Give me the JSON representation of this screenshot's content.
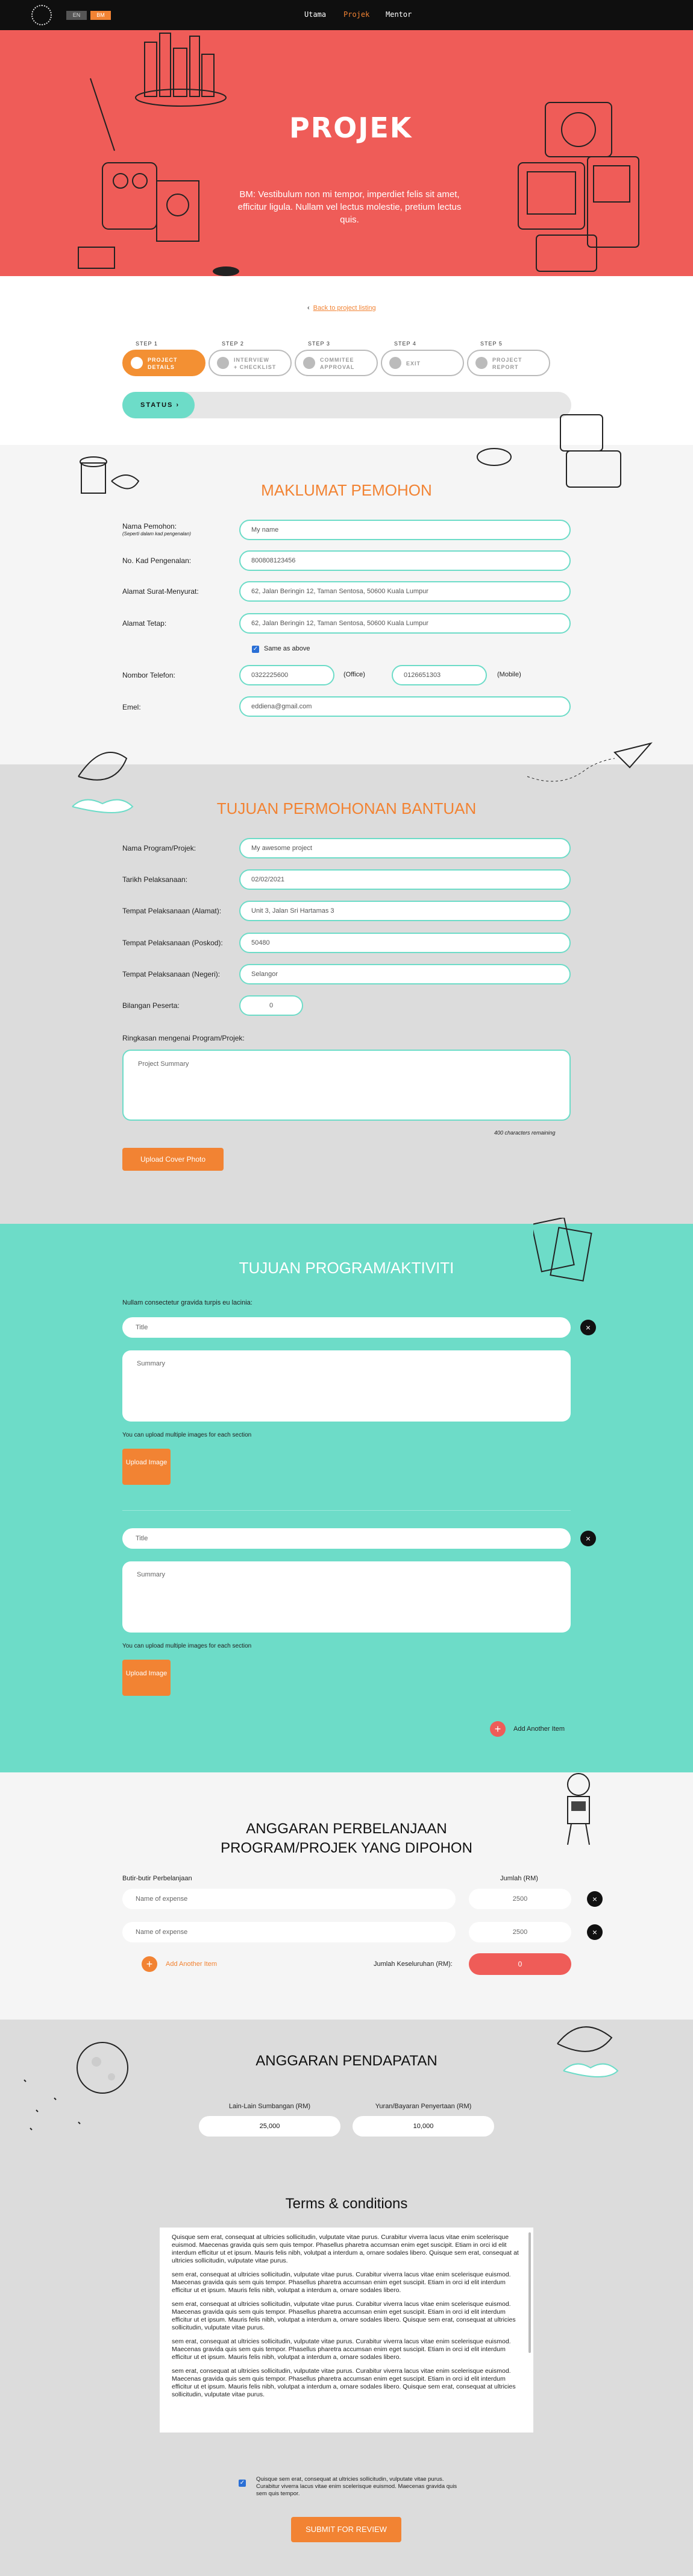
{
  "nav": {
    "lang_en": "EN",
    "lang_bm": "BM",
    "items": [
      "Utama",
      "Projek",
      "Mentor"
    ]
  },
  "hero": {
    "title": "PROJEK",
    "description": "BM: Vestibulum non mi tempor, imperdiet felis sit amet, efficitur ligula. Nullam vel lectus molestie, pretium lectus quis."
  },
  "back_link": "Back to project listing",
  "steps": [
    {
      "num": "STEP 1",
      "line1": "PROJECT",
      "line2": "DETAILS",
      "active": true
    },
    {
      "num": "STEP 2",
      "line1": "INTERVIEW",
      "line2": "+ CHECKLIST",
      "active": false
    },
    {
      "num": "STEP 3",
      "line1": "COMMITEE",
      "line2": "APPROVAL",
      "active": false
    },
    {
      "num": "STEP 4",
      "line1": "EXIT",
      "line2": "",
      "active": false
    },
    {
      "num": "STEP 5",
      "line1": "PROJECT",
      "line2": "REPORT",
      "active": false
    }
  ],
  "status_label": "STATUS ›",
  "maklumat": {
    "title": "MAKLUMAT PEMOHON",
    "nama_label": "Nama Pemohon:",
    "nama_note": "(Seperti dalam kad pengenalan)",
    "nama_value": "My name",
    "ic_label": "No. Kad Pengenalan:",
    "ic_value": "800808123456",
    "alamat_surat_label": "Alamat Surat-Menyurat:",
    "alamat_surat_value": "62, Jalan Beringin 12, Taman Sentosa, 50600 Kuala Lumpur",
    "alamat_tetap_label": "Alamat Tetap:",
    "alamat_tetap_value": "62, Jalan Beringin 12, Taman Sentosa, 50600 Kuala Lumpur",
    "same_as_above": "Same as above",
    "tel_label": "Nombor Telefon:",
    "tel_office": "0322225600",
    "tel_office_suffix": "(Office)",
    "tel_mobile": "0126651303",
    "tel_mobile_suffix": "(Mobile)",
    "emel_label": "Emel:",
    "emel_value": "eddiena@gmail.com"
  },
  "tujuan": {
    "title": "TUJUAN PERMOHONAN BANTUAN",
    "nama_program_label": "Nama Program/Projek:",
    "nama_program_value": "My awesome project",
    "tarikh_label": "Tarikh Pelaksanaan:",
    "tarikh_value": "02/02/2021",
    "alamat_label": "Tempat Pelaksanaan (Alamat):",
    "alamat_value": "Unit 3, Jalan Sri Hartamas 3",
    "poskod_label": "Tempat Pelaksanaan (Poskod):",
    "poskod_value": "50480",
    "negeri_label": "Tempat Pelaksanaan (Negeri):",
    "negeri_value": "Selangor",
    "peserta_label": "Bilangan Peserta:",
    "peserta_value": "0",
    "ringkasan_label": "Ringkasan mengenai Program/Projek:",
    "ringkasan_placeholder": "Project Summary",
    "chars_remaining": "400 characters remaining",
    "upload_cover": "Upload Cover Photo"
  },
  "aktiviti": {
    "title": "TUJUAN PROGRAM/AKTIVITI",
    "intro": "Nullam consectetur gravida turpis eu lacinia:",
    "blocks": [
      {
        "title_placeholder": "Title",
        "summary_placeholder": "Summary",
        "note": "You can upload multiple images for each section",
        "upload": "Upload Image"
      },
      {
        "title_placeholder": "Title",
        "summary_placeholder": "Summary",
        "note": "You can upload multiple images for each section",
        "upload": "Upload Image"
      }
    ],
    "add_item": "Add Another Item"
  },
  "belanja": {
    "title_line1": "ANGGARAN PERBELANJAAN",
    "title_line2": "PROGRAM/PROJEK YANG DIPOHON",
    "col_items": "Butir-butir Perbelanjaan",
    "col_amount": "Jumlah (RM)",
    "rows": [
      {
        "name": "Name of expense",
        "amount": "2500"
      },
      {
        "name": "Name of expense",
        "amount": "2500"
      }
    ],
    "add_item": "Add Another Item",
    "total_label": "Jumlah Keseluruhan (RM):",
    "total_value": "0"
  },
  "pendapatan": {
    "title": "ANGGARAN PENDAPATAN",
    "col1_label": "Lain-Lain Sumbangan (RM)",
    "col1_value": "25,000",
    "col2_label": "Yuran/Bayaran Penyertaan (RM)",
    "col2_value": "10,000"
  },
  "terms": {
    "title": "Terms & conditions",
    "paragraphs": [
      "Quisque sem erat, consequat at ultricies sollicitudin, vulputate vitae purus. Curabitur viverra lacus vitae enim scelerisque euismod. Maecenas gravida quis sem quis tempor. Phasellus pharetra accumsan enim eget suscipit. Etiam in orci id elit interdum efficitur ut et ipsum. Mauris felis nibh, volutpat a interdum a, ornare sodales libero. Quisque sem erat, consequat at ultricies sollicitudin, vulputate vitae purus.",
      "sem erat, consequat at ultricies sollicitudin, vulputate vitae purus. Curabitur viverra lacus vitae enim scelerisque euismod. Maecenas gravida quis sem quis tempor. Phasellus pharetra accumsan enim eget suscipit. Etiam in orci id elit interdum efficitur ut et ipsum. Mauris felis nibh, volutpat a interdum a, ornare sodales libero.",
      "sem erat, consequat at ultricies sollicitudin, vulputate vitae purus. Curabitur viverra lacus vitae enim scelerisque euismod. Maecenas gravida quis sem quis tempor. Phasellus pharetra accumsan enim eget suscipit. Etiam in orci id elit interdum efficitur ut et ipsum. Mauris felis nibh, volutpat a interdum a, ornare sodales libero. Quisque sem erat, consequat at ultricies sollicitudin, vulputate vitae purus.",
      "sem erat, consequat at ultricies sollicitudin, vulputate vitae purus. Curabitur viverra lacus vitae enim scelerisque euismod. Maecenas gravida quis sem quis tempor. Phasellus pharetra accumsan enim eget suscipit. Etiam in orci id elit interdum efficitur ut et ipsum. Mauris felis nibh, volutpat a interdum a, ornare sodales libero.",
      "sem erat, consequat at ultricies sollicitudin, vulputate vitae purus. Curabitur viverra lacus vitae enim scelerisque euismod. Maecenas gravida quis sem quis tempor. Phasellus pharetra accumsan enim eget suscipit. Etiam in orci id elit interdum efficitur ut et ipsum. Mauris felis nibh, volutpat a interdum a, ornare sodales libero. Quisque sem erat, consequat at ultricies sollicitudin, vulputate vitae purus."
    ],
    "agree_text": "Quisque sem erat, consequat at ultricies sollicitudin, vulputate vitae purus. Curabitur viverra lacus vitae enim scelerisque euismod. Maecenas gravida quis sem quis tempor.",
    "submit": "SUBMIT FOR REVIEW"
  },
  "colors": {
    "hero": "#ef5c58",
    "accent": "#f28333",
    "teal": "#6ddcc8",
    "grey_section": "#dcdcdc",
    "light_section": "#f5f5f5"
  }
}
